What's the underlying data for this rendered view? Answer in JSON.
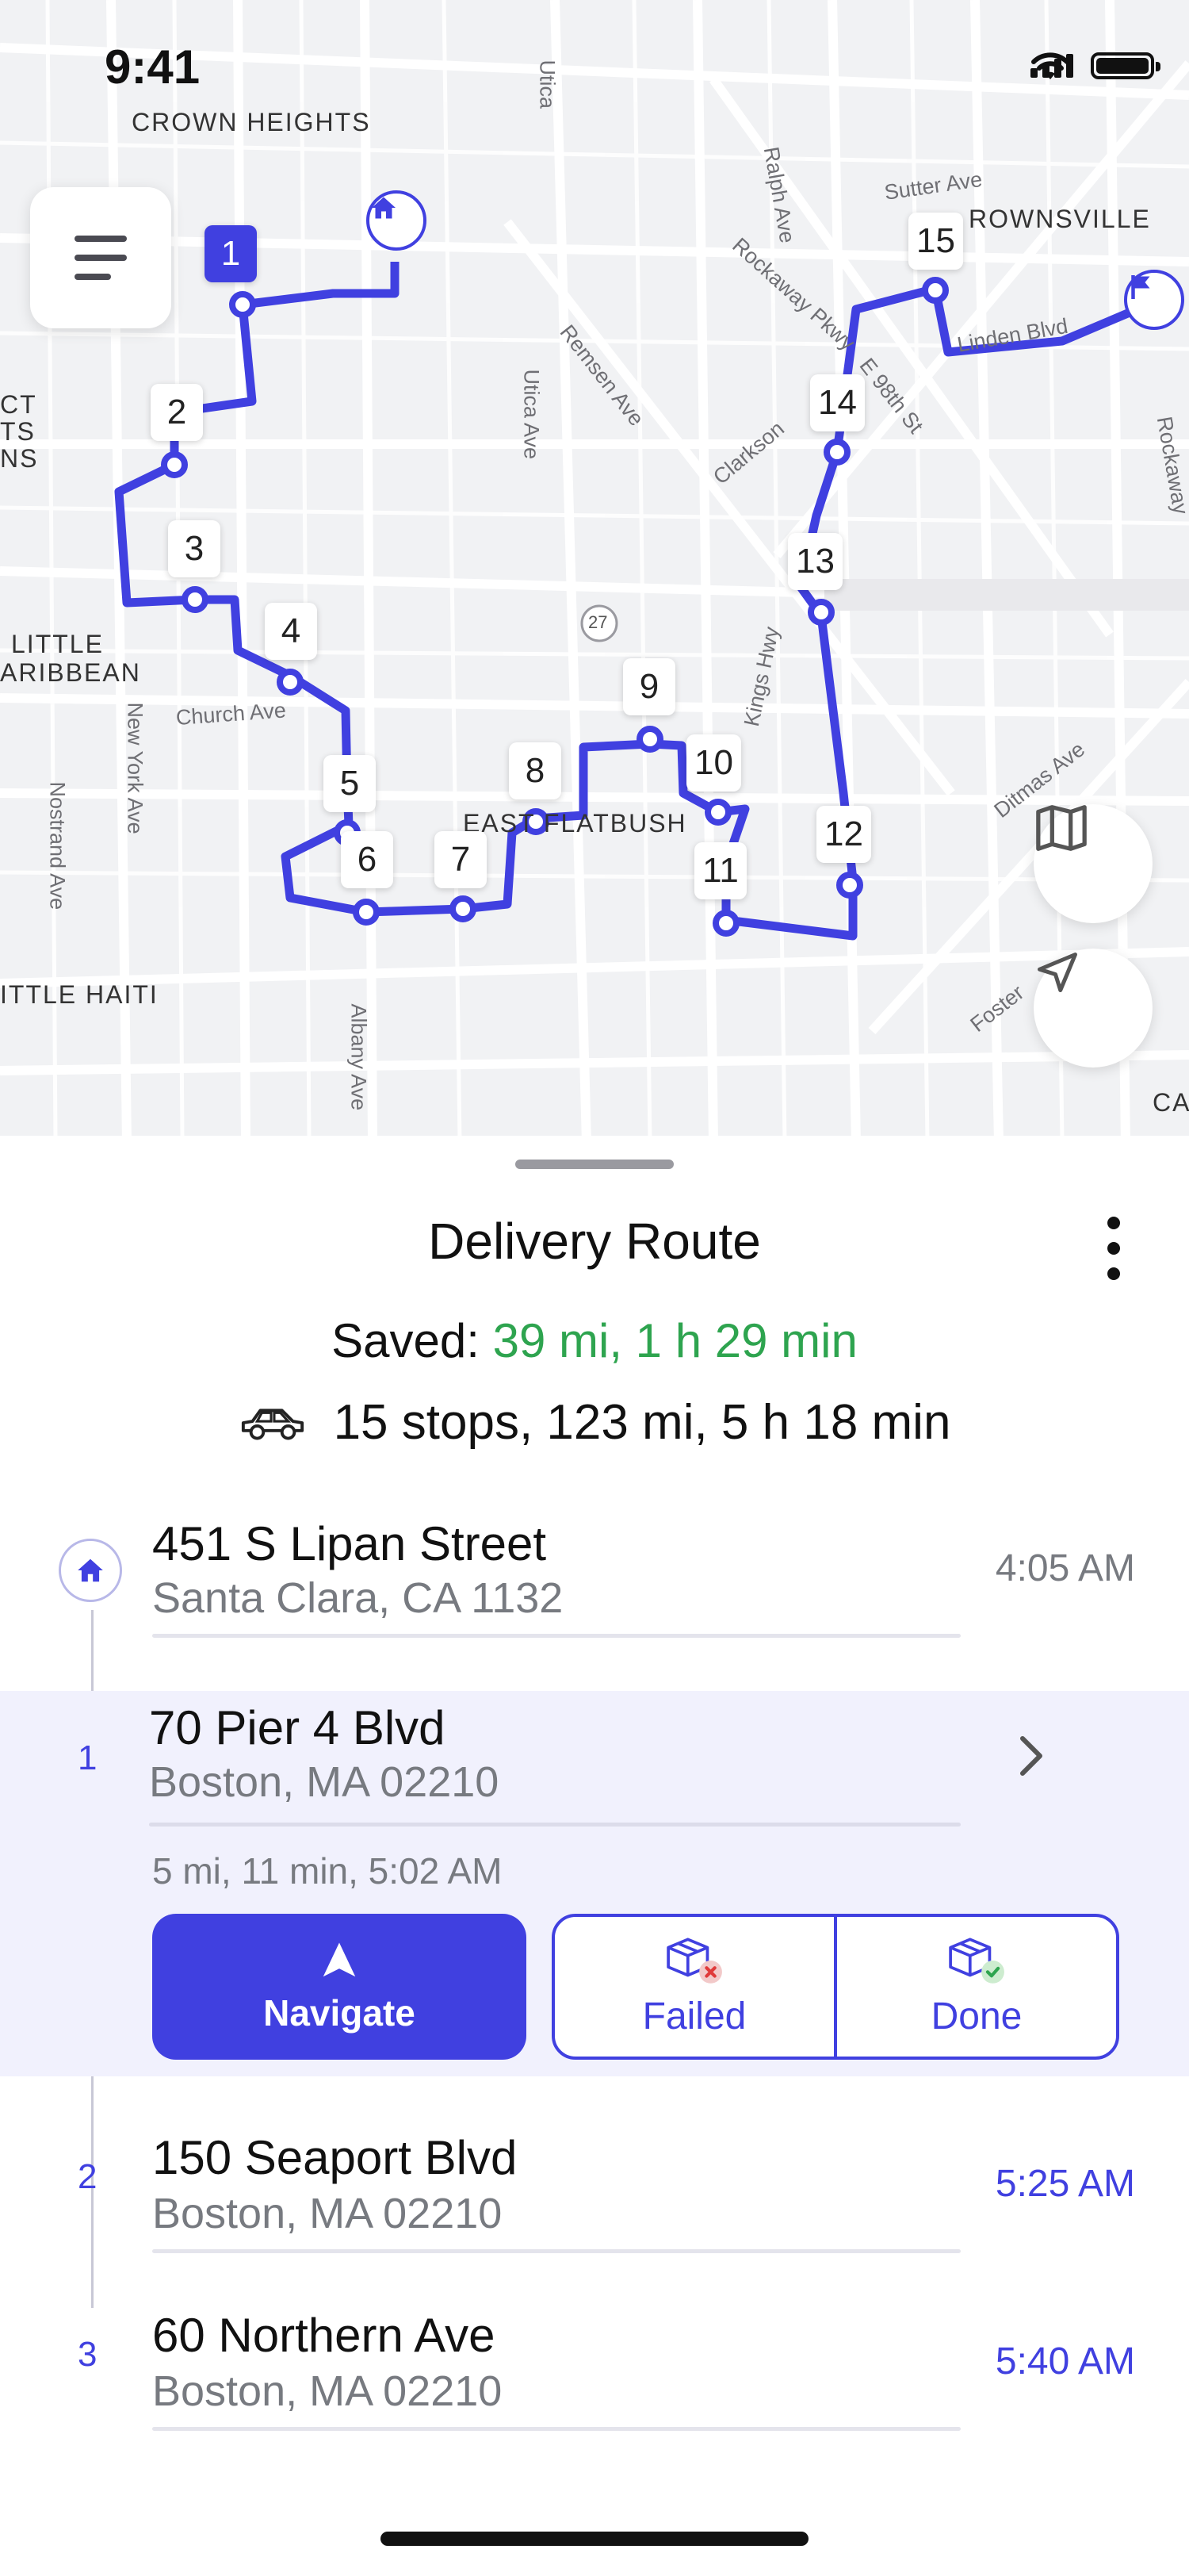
{
  "status_bar": {
    "time": "9:41"
  },
  "map": {
    "neighborhoods": [
      "CROWN HEIGHTS",
      "ROWNSVILLE",
      "LITTLE",
      "ARIBBEAN",
      "ITTLE HAITI",
      "EAST FLATBUSH",
      "CT",
      "TS",
      "NS",
      "CA"
    ],
    "streets": [
      "Utica",
      "Ralph Ave",
      "Sutter Ave",
      "Rockaway Pkwy",
      "E 98th St",
      "Remsen Ave",
      "Clarkson",
      "Utica Ave",
      "New York Ave",
      "Church Ave",
      "Nostrand Ave",
      "Albany Ave",
      "Kings Hwy",
      "Ditmas Ave",
      "Foster",
      "Linden Blvd",
      "Rockaway"
    ],
    "route_markers": [
      "1",
      "2",
      "3",
      "4",
      "5",
      "6",
      "7",
      "8",
      "9",
      "10",
      "11",
      "12",
      "13",
      "14",
      "15"
    ],
    "route_badge": "27"
  },
  "sheet": {
    "title": "Delivery Route",
    "saved_label": "Saved:",
    "saved_value": "39 mi, 1 h 29 min",
    "summary": "15 stops, 123 mi, 5 h 18 min",
    "start": {
      "address": "451 S Lipan Street",
      "city": "Santa Clara, CA 1132",
      "time": "4:05 AM"
    },
    "active_stop": {
      "number": "1",
      "address": "70 Pier 4 Blvd",
      "city": "Boston, MA 02210",
      "eta": "5 mi, 11 min, 5:02 AM",
      "navigate_label": "Navigate",
      "failed_label": "Failed",
      "done_label": "Done"
    },
    "stops": [
      {
        "number": "2",
        "address": "150 Seaport Blvd",
        "city": "Boston, MA 02210",
        "time": "5:25 AM"
      },
      {
        "number": "3",
        "address": "60 Northern Ave",
        "city": "Boston, MA 02210",
        "time": "5:40 AM"
      }
    ]
  },
  "colors": {
    "accent": "#4040e0",
    "saved": "#2ea44f",
    "active_bg": "#f1f1fd"
  }
}
